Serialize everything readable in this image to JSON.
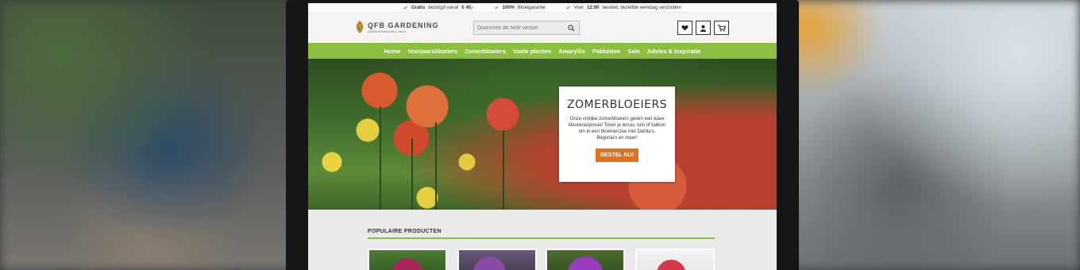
{
  "usp_bar": [
    {
      "strong": "Gratis",
      "text": "bezorgd vanaf",
      "strong2": "€ 40,-"
    },
    {
      "strong": "100%",
      "text": "Bloeigarantie",
      "strong2": ""
    },
    {
      "strong": "",
      "text": "Voor",
      "strong2": "12:00",
      "text2": "besteld, dezelfde werkdag verzonden"
    }
  ],
  "logo": {
    "name": "QFB GARDENING",
    "tagline": "Quality flowerbulbs & more"
  },
  "search": {
    "placeholder": "Doorzoek de hele winkel",
    "icon": "search-icon"
  },
  "header_actions": [
    {
      "icon": "heart-icon",
      "name": "wishlist-button"
    },
    {
      "icon": "user-icon",
      "name": "account-button"
    },
    {
      "icon": "cart-icon",
      "name": "cart-button"
    }
  ],
  "nav": {
    "items": [
      "Home",
      "Voorjaarsbloeiers",
      "Zomerbloeiers",
      "Vaste planten",
      "Amaryllis",
      "Pakketten",
      "Sale",
      "Advies & Inspiratie"
    ]
  },
  "hero": {
    "title": "ZOMERBLOEIERS",
    "text": "Onze vrolijke zomerbloeiers geven een ware kleurenexplosie! Tover je terras, tuin of balkon om in een bloemenzee met Dahlia's, Begonia's en meer!",
    "cta": "BESTEL NU!"
  },
  "popular": {
    "title": "POPULAIRE PRODUCTEN"
  },
  "colors": {
    "accent_green": "#8cbf3f",
    "cta_orange": "#e3711c"
  }
}
